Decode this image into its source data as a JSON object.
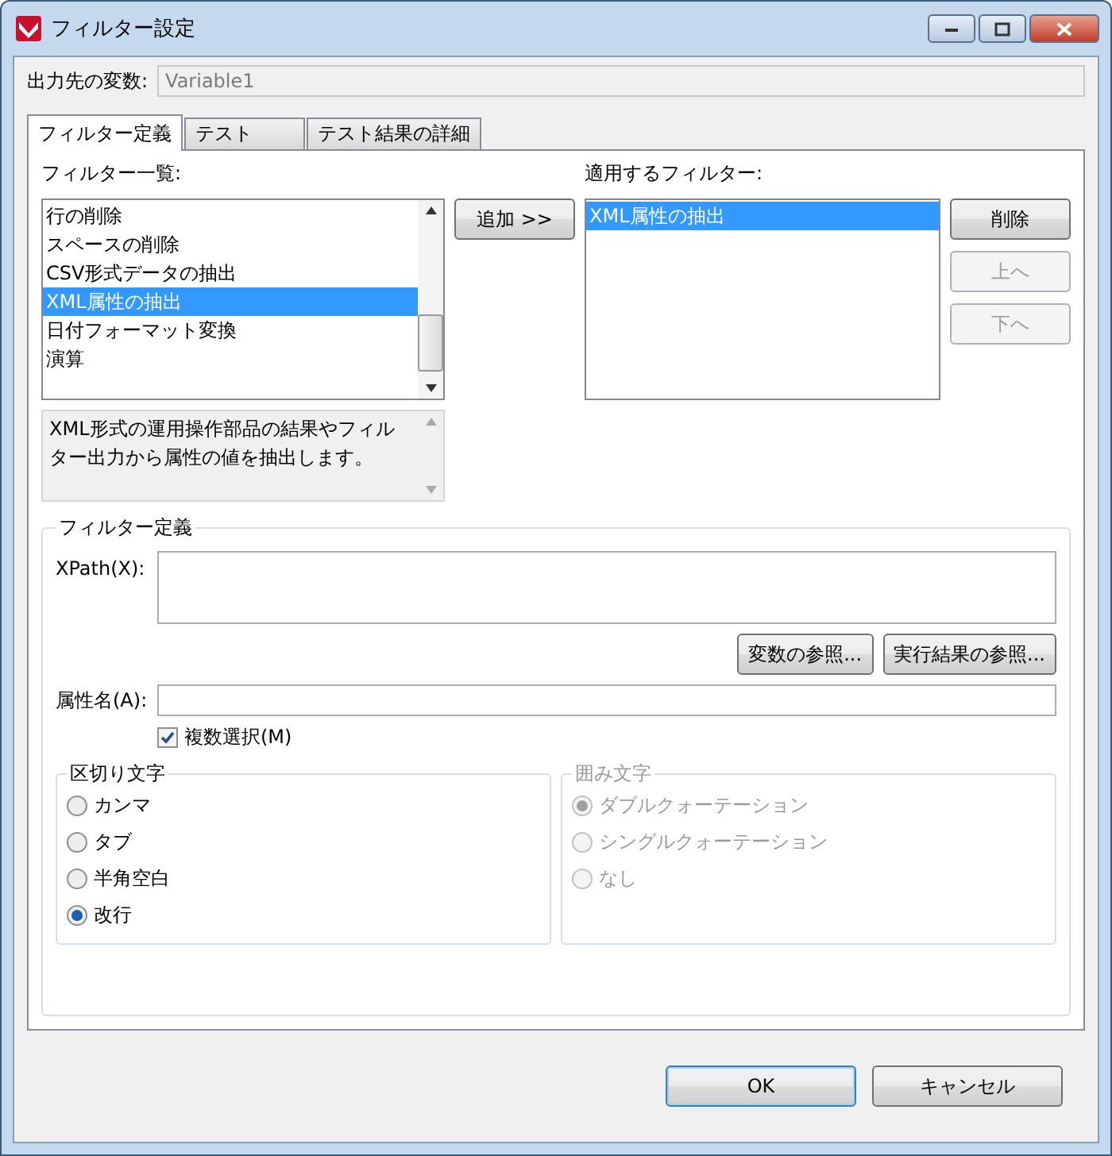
{
  "window": {
    "title": "フィルター設定"
  },
  "output_variable": {
    "label": "出力先の変数:",
    "value": "Variable1",
    "disabled": true
  },
  "tabs": [
    {
      "label": "フィルター定義",
      "selected": true
    },
    {
      "label": "テスト",
      "selected": false
    },
    {
      "label": "テスト結果の詳細",
      "selected": false
    }
  ],
  "filter_list": {
    "label": "フィルター一覧:",
    "items": [
      {
        "label": "行の削除",
        "selected": false
      },
      {
        "label": "スペースの削除",
        "selected": false
      },
      {
        "label": "CSV形式データの抽出",
        "selected": false
      },
      {
        "label": "XML属性の抽出",
        "selected": true
      },
      {
        "label": "日付フォーマット変換",
        "selected": false
      },
      {
        "label": "演算",
        "selected": false
      }
    ]
  },
  "description": "XML形式の運用操作部品の結果やフィルター出力から属性の値を抽出します。",
  "add_button": {
    "label": "追加 >>",
    "disabled": false
  },
  "applied_filters": {
    "label": "適用するフィルター:",
    "items": [
      {
        "label": "XML属性の抽出",
        "selected": true
      }
    ]
  },
  "side_buttons": [
    {
      "label": "削除",
      "disabled": false
    },
    {
      "label": "上へ",
      "disabled": true
    },
    {
      "label": "下へ",
      "disabled": true
    }
  ],
  "definition": {
    "title": "フィルター定義",
    "xpath": {
      "label": "XPath(X):"
    },
    "ref_buttons": [
      {
        "label": "変数の参照..."
      },
      {
        "label": "実行結果の参照..."
      }
    ],
    "attribute": {
      "label": "属性名(A):"
    },
    "multi_select": {
      "label": "複数選択(M)",
      "checked": true
    },
    "groups": [
      {
        "title": "区切り文字",
        "disabled": false,
        "options": [
          {
            "label": "カンマ",
            "selected": false
          },
          {
            "label": "タブ",
            "selected": false
          },
          {
            "label": "半角空白",
            "selected": false
          },
          {
            "label": "改行",
            "selected": true
          }
        ]
      },
      {
        "title": "囲み文字",
        "disabled": true,
        "options": [
          {
            "label": "ダブルクォーテーション",
            "selected": true
          },
          {
            "label": "シングルクォーテーション",
            "selected": false
          },
          {
            "label": "なし",
            "selected": false
          }
        ]
      }
    ]
  },
  "footer_buttons": [
    {
      "label": "OK",
      "default": true
    },
    {
      "label": "キャンセル",
      "default": false
    }
  ]
}
